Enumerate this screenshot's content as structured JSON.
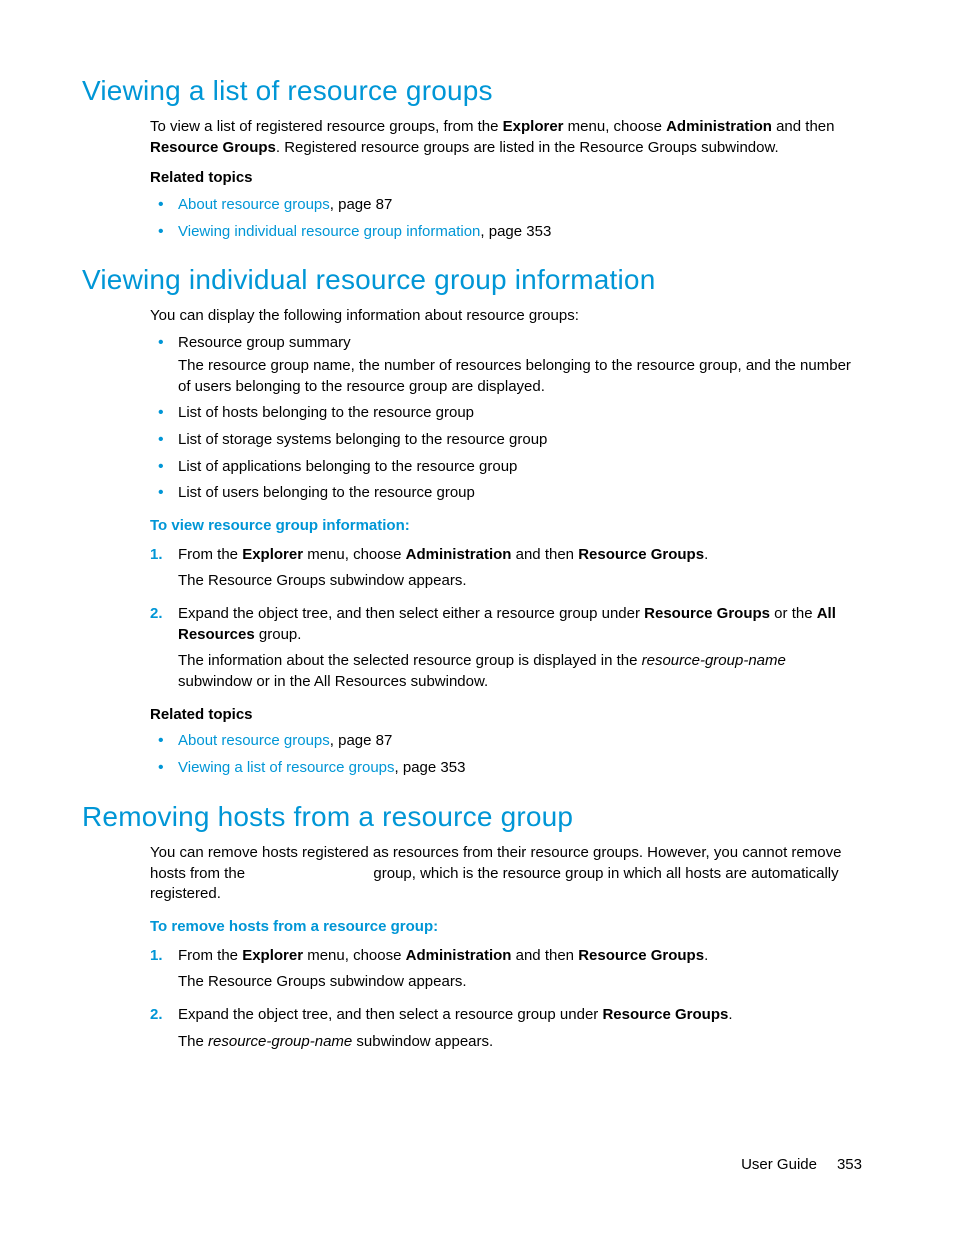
{
  "section1": {
    "heading": "Viewing a list of resource groups",
    "intro_p1": "To view a list of registered resource groups, from the ",
    "intro_b1": "Explorer",
    "intro_p2": " menu, choose ",
    "intro_b2": "Administration",
    "intro_p3": " and then ",
    "intro_b3": "Resource Groups",
    "intro_p4": ". Registered resource groups are listed in the Resource Groups subwindow.",
    "related_label": "Related topics",
    "related": [
      {
        "link": "About resource groups",
        "suffix": ", page 87"
      },
      {
        "link": "Viewing individual resource group information",
        "suffix": ", page 353"
      }
    ]
  },
  "section2": {
    "heading": "Viewing individual resource group information",
    "intro": "You can display the following information about resource groups:",
    "bullets": [
      {
        "title": "Resource group summary",
        "desc": "The resource group name, the number of resources belonging to the resource group, and the number of users belonging to the resource group are displayed."
      },
      {
        "title": "List of hosts belonging to the resource group"
      },
      {
        "title": "List of storage systems belonging to the resource group"
      },
      {
        "title": "List of applications belonging to the resource group"
      },
      {
        "title": "List of users belonging to the resource group"
      }
    ],
    "proc_label": "To view resource group information:",
    "step1_a": "From the ",
    "step1_b1": "Explorer",
    "step1_b": " menu, choose ",
    "step1_b2": "Administration",
    "step1_c": " and then ",
    "step1_b3": "Resource Groups",
    "step1_d": ".",
    "step1_result": "The Resource Groups subwindow appears.",
    "step2_a": "Expand the object tree, and then select either a resource group under ",
    "step2_b1": "Resource Groups",
    "step2_b": " or the ",
    "step2_b2": "All Resources",
    "step2_c": " group.",
    "step2_result_a": "The information about the selected resource group is displayed in the ",
    "step2_result_i": "resource-group-name",
    "step2_result_b": " subwindow or in the All Resources subwindow.",
    "related_label": "Related topics",
    "related": [
      {
        "link": "About resource groups",
        "suffix": ", page 87"
      },
      {
        "link": "Viewing a list of resource groups",
        "suffix": ", page 353"
      }
    ]
  },
  "section3": {
    "heading": "Removing hosts from a resource group",
    "intro_a": "You can remove hosts registered as resources from their resource groups. However, you cannot remove hosts from the ",
    "intro_b": " group, which is the resource group in which all hosts are automatically registered.",
    "proc_label": "To remove hosts from a resource group:",
    "step1_a": "From the ",
    "step1_b1": "Explorer",
    "step1_b": " menu, choose ",
    "step1_b2": "Administration",
    "step1_c": " and then ",
    "step1_b3": "Resource Groups",
    "step1_d": ".",
    "step1_result": "The Resource Groups subwindow appears.",
    "step2_a": "Expand the object tree, and then select a resource group under ",
    "step2_b1": "Resource Groups",
    "step2_b": ".",
    "step2_result_a": "The ",
    "step2_result_i": "resource-group-name",
    "step2_result_b": " subwindow appears."
  },
  "footer": {
    "label": "User Guide",
    "page": "353"
  }
}
